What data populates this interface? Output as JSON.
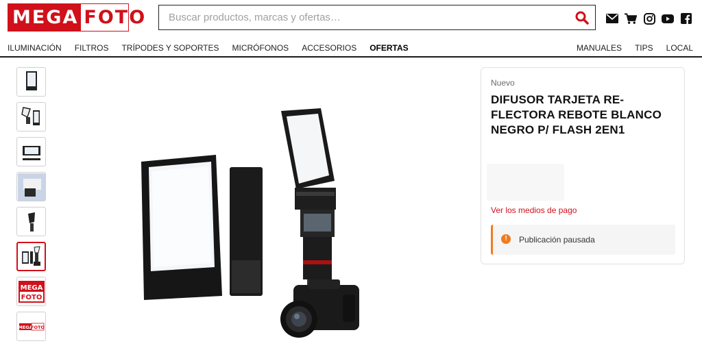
{
  "brand": {
    "logo_part1": "MEGA",
    "logo_part2": "FOTO",
    "accent": "#d0101a"
  },
  "search": {
    "placeholder": "Buscar productos, marcas y ofertas…"
  },
  "social_icons": [
    "mail-icon",
    "cart-icon",
    "instagram-icon",
    "youtube-icon",
    "facebook-icon"
  ],
  "nav": {
    "left": [
      "ILUMINACIÓN",
      "FILTROS",
      "TRÍPODES Y SOPORTES",
      "MICRÓFONOS",
      "ACCESORIOS",
      "OFERTAS"
    ],
    "right": [
      "MANUALES",
      "TIPS",
      "LOCAL"
    ],
    "active": "OFERTAS"
  },
  "thumbnails": {
    "count": 8,
    "selected_index": 5
  },
  "product": {
    "condition": "Nuevo",
    "title": "DIFUSOR TARJETA RE-FLECTORA REBOTE BLANCO NEGRO P/ FLASH 2EN1",
    "payment_link": "Ver los medios de pago",
    "status_message": "Publicación pausada",
    "status_color": "#f07b1f"
  }
}
